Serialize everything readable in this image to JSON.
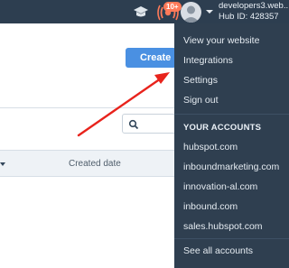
{
  "topbar": {
    "notification_count": "10+",
    "account_name": "developers3.web...",
    "hub_id": "Hub ID: 428357"
  },
  "page": {
    "create_label": "Create",
    "column_created": "Created date"
  },
  "dropdown": {
    "top_items": [
      "View your website",
      "Integrations",
      "Settings",
      "Sign out"
    ],
    "accounts_heading": "YOUR ACCOUNTS",
    "accounts": [
      "hubspot.com",
      "inboundmarketing.com",
      "innovation-al.com",
      "inbound.com",
      "sales.hubspot.com"
    ],
    "see_all": "See all accounts"
  },
  "colors": {
    "topbar": "#2d3e50",
    "dropdown": "#2f3f50",
    "accent_button": "#4a90e2",
    "badge": "#ff7a59",
    "annotation_arrow": "#e8231c"
  },
  "icons": [
    "graduation-cap-icon",
    "notifications-icon",
    "avatar-icon",
    "chevron-down-icon",
    "search-icon",
    "sort-caret-icon"
  ]
}
